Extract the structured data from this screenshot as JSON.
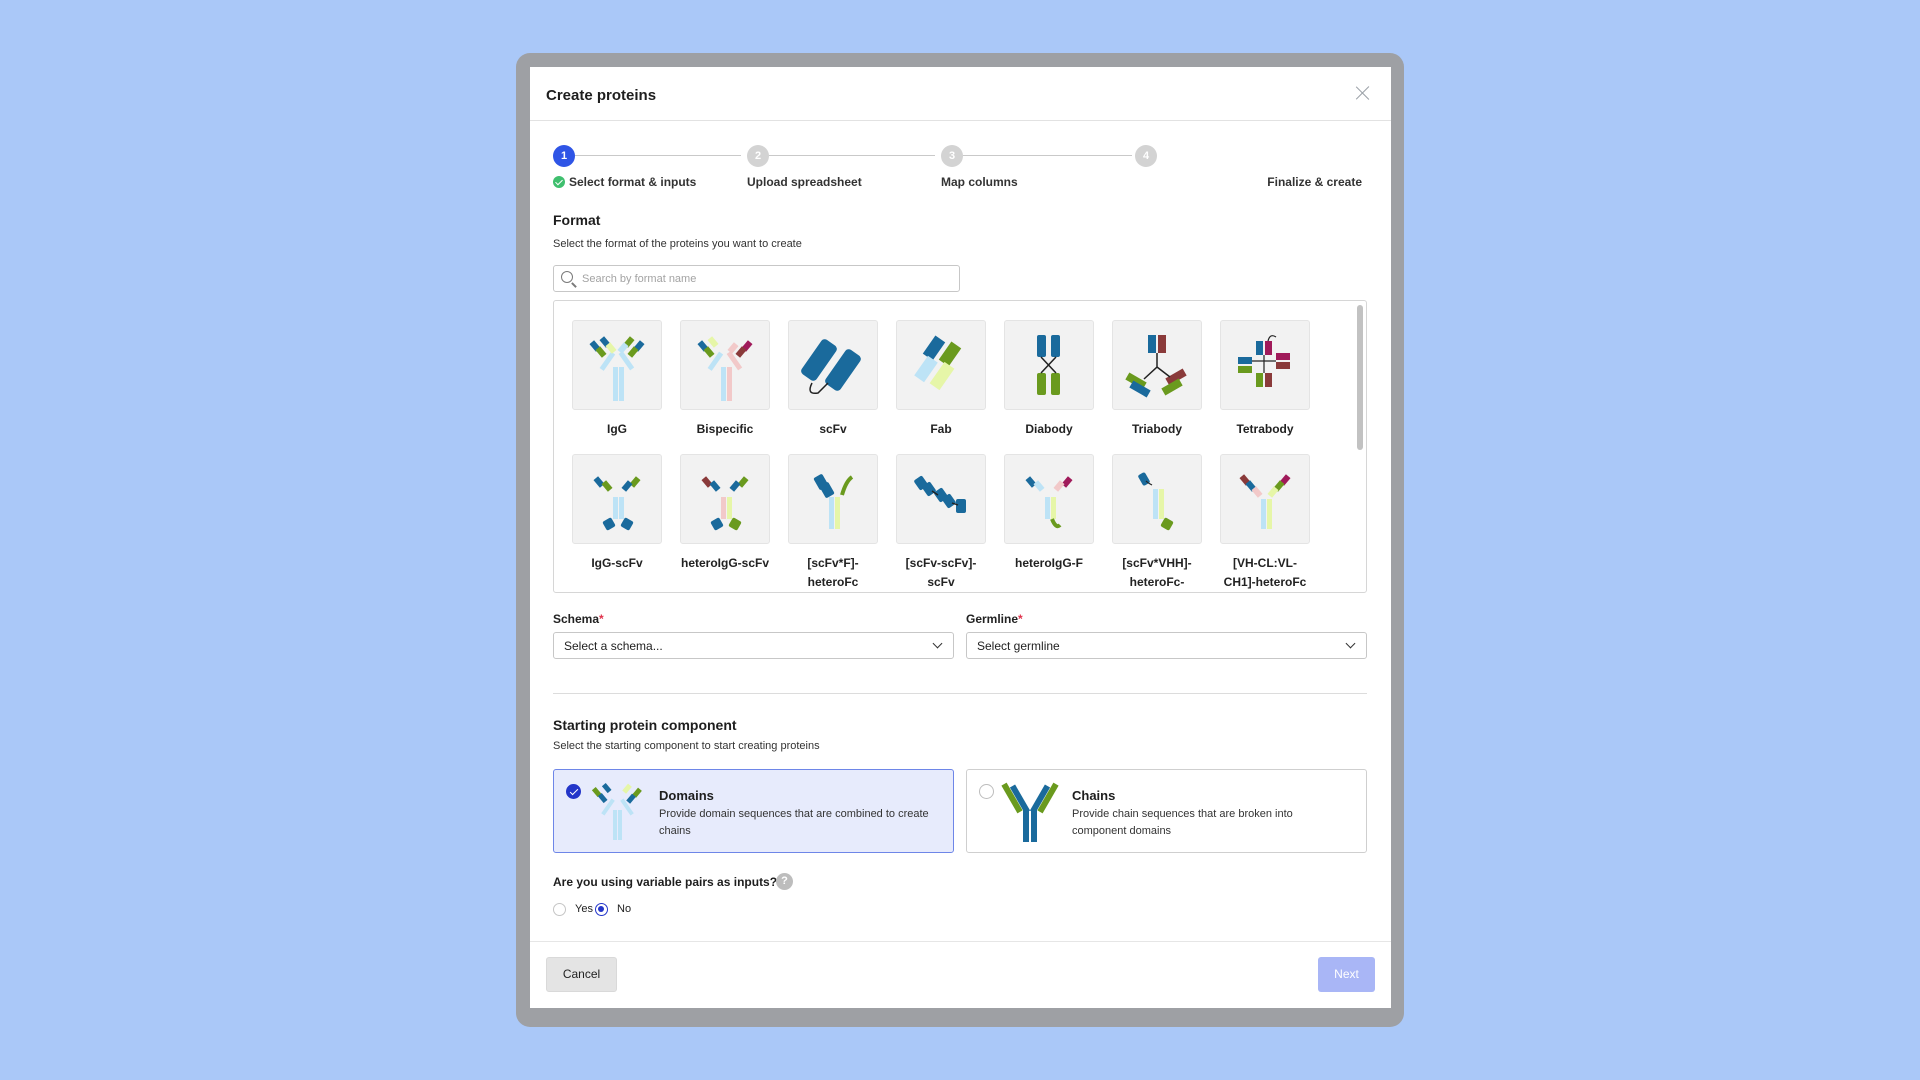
{
  "dialog": {
    "title": "Create proteins"
  },
  "steps": [
    {
      "number": "1",
      "label": "Select format & inputs",
      "state": "active"
    },
    {
      "number": "2",
      "label": "Upload spreadsheet",
      "state": "pending"
    },
    {
      "number": "3",
      "label": "Map columns",
      "state": "pending"
    },
    {
      "number": "4",
      "label": "Finalize & create",
      "state": "pending"
    }
  ],
  "format": {
    "title": "Format",
    "subtitle": "Select the format of the proteins you want to create",
    "search_placeholder": "Search by format name",
    "items": [
      {
        "label": "IgG",
        "icon": "igg-icon"
      },
      {
        "label": "Bispecific",
        "icon": "bispecific-icon"
      },
      {
        "label": "scFv",
        "icon": "scfv-icon"
      },
      {
        "label": "Fab",
        "icon": "fab-icon"
      },
      {
        "label": "Diabody",
        "icon": "diabody-icon"
      },
      {
        "label": "Triabody",
        "icon": "triabody-icon"
      },
      {
        "label": "Tetrabody",
        "icon": "tetrabody-icon"
      },
      {
        "label": "IgG-scFv",
        "icon": "igg-scfv-icon"
      },
      {
        "label": "heteroIgG-scFv",
        "icon": "heteroigg-scfv-icon"
      },
      {
        "label": "[scFv*F]-heteroFc",
        "icon": "scfv-f-heterofc-icon"
      },
      {
        "label": "[scFv-scFv]-scFv",
        "icon": "scfv-scfv-scfv-icon"
      },
      {
        "label": "heteroIgG-F",
        "icon": "heteroigg-f-icon"
      },
      {
        "label": "[scFv*VHH]-heteroFc-",
        "icon": "scfv-vhh-heterofc-icon"
      },
      {
        "label": "[VH-CL:VL-CH1]-heteroFc",
        "icon": "vh-cl-vl-ch1-heterofc-icon"
      }
    ]
  },
  "schema": {
    "label": "Schema",
    "required_mark": "*",
    "value": "Select a schema..."
  },
  "germline": {
    "label": "Germline",
    "required_mark": "*",
    "value": "Select germline"
  },
  "starting": {
    "title": "Starting protein component",
    "subtitle": "Select the starting component to start creating proteins",
    "options": [
      {
        "title": "Domains",
        "description": "Provide domain sequences that are combined to create chains",
        "selected": true
      },
      {
        "title": "Chains",
        "description": "Provide chain sequences that are broken into component domains",
        "selected": false
      }
    ]
  },
  "variable_pairs": {
    "question": "Are you using variable pairs as inputs?",
    "help": "?",
    "options": [
      {
        "label": "Yes",
        "selected": false
      },
      {
        "label": "No",
        "selected": true
      }
    ]
  },
  "footer": {
    "cancel_label": "Cancel",
    "next_label": "Next"
  },
  "colors": {
    "accent": "#2f55e6",
    "background": "#aac8f8",
    "domain_blue": "#1a6a9c",
    "domain_green": "#6a9a1e",
    "light_blue": "#bde3f6",
    "light_yellow": "#e6f6a8",
    "pink": "#f2c9c9",
    "maroon": "#8a3a3a",
    "magenta": "#a01a5a"
  }
}
